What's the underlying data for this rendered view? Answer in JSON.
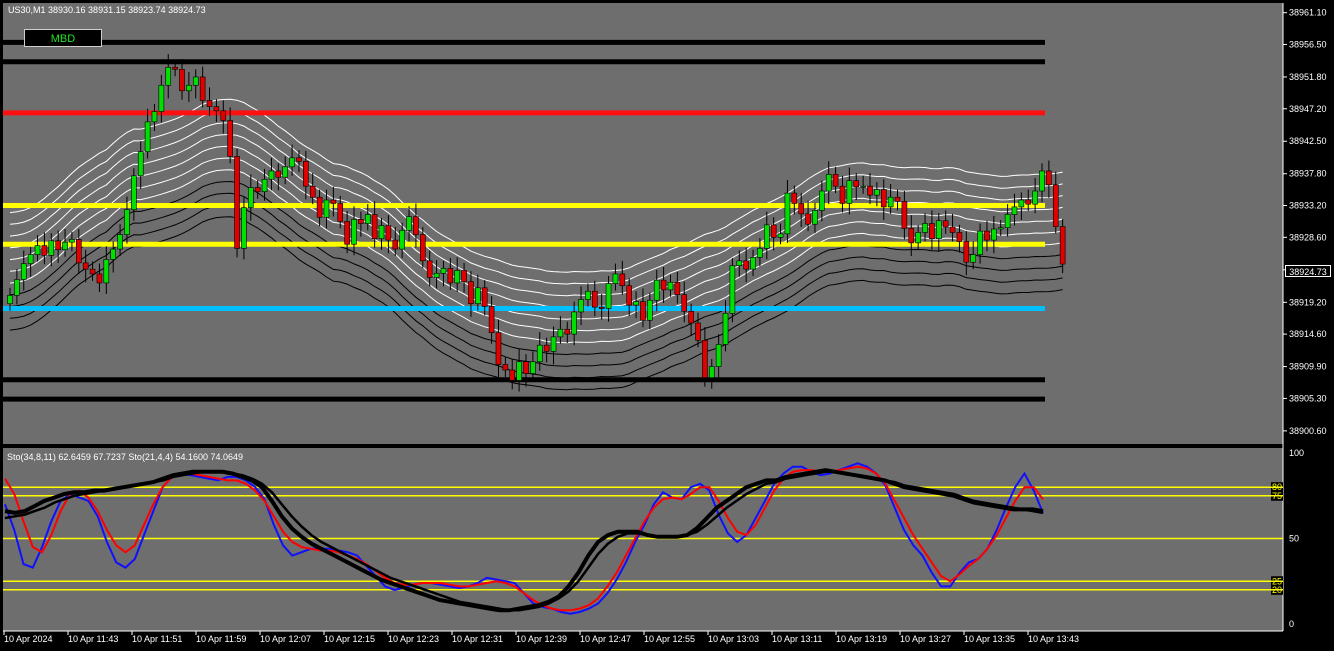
{
  "colors": {
    "background": "#000000",
    "plot_bg": "#6e6e6e",
    "bull": "#00e000",
    "bear": "#e00000",
    "envelope": "#ffffff",
    "level_black": "#000000",
    "level_red": "#ff1010",
    "level_yellow": "#ffff00",
    "level_blue": "#00c0ff",
    "stoch_blue": "#1010ff",
    "stoch_red": "#ff0000",
    "stoch_black": "#000000"
  },
  "header": {
    "symbol_line": "US30,M1  38930.16 38931.15 38923.74 38924.73"
  },
  "mbd_button": "MBD",
  "last_price": "38924.73",
  "chart_data": [
    {
      "type": "candlestick",
      "title": "US30,M1",
      "ohlc": {
        "open": 38930.16,
        "high": 38931.15,
        "low": 38923.74,
        "close": 38924.73
      },
      "ylim": [
        38898.7,
        38962.5
      ],
      "y_ticks": [
        "38961.10",
        "38956.50",
        "38951.80",
        "38947.20",
        "38942.50",
        "38937.80",
        "38933.20",
        "38928.60",
        "38923.90",
        "38919.20",
        "38914.60",
        "38909.90",
        "38905.30",
        "38900.60"
      ],
      "x_ticks": [
        "10 Apr 2024",
        "10 Apr 11:43",
        "10 Apr 11:51",
        "10 Apr 11:59",
        "10 Apr 12:07",
        "10 Apr 12:15",
        "10 Apr 12:23",
        "10 Apr 12:31",
        "10 Apr 12:39",
        "10 Apr 12:47",
        "10 Apr 12:55",
        "10 Apr 13:03",
        "10 Apr 13:11",
        "10 Apr 13:19",
        "10 Apr 13:27",
        "10 Apr 13:35",
        "10 Apr 13:43"
      ],
      "levels": [
        {
          "price": 38956.8,
          "color": "black"
        },
        {
          "price": 38954.0,
          "color": "black"
        },
        {
          "price": 38946.6,
          "color": "red"
        },
        {
          "price": 38933.2,
          "color": "yellow"
        },
        {
          "price": 38927.6,
          "color": "yellow"
        },
        {
          "price": 38918.3,
          "color": "blue"
        },
        {
          "price": 38908.0,
          "color": "black"
        },
        {
          "price": 38905.2,
          "color": "black"
        }
      ],
      "closes": [
        38920.2,
        38922.5,
        38924.8,
        38926.1,
        38927.4,
        38926.0,
        38928.1,
        38926.8,
        38927.9,
        38928.3,
        38924.9,
        38924.0,
        38923.3,
        38922.0,
        38925.4,
        38926.9,
        38929.0,
        38932.6,
        38937.5,
        38941.0,
        38945.3,
        38946.8,
        38950.6,
        38953.2,
        38952.9,
        38949.8,
        38950.6,
        38951.8,
        38948.4,
        38947.5,
        38946.9,
        38945.5,
        38940.3,
        38927.0,
        38932.9,
        38935.8,
        38935.2,
        38937.0,
        38938.2,
        38937.3,
        38938.8,
        38940.1,
        38939.6,
        38936.0,
        38934.4,
        38931.5,
        38934.0,
        38933.5,
        38930.9,
        38927.6,
        38931.2,
        38930.6,
        38931.9,
        38928.4,
        38930.3,
        38928.2,
        38926.9,
        38929.6,
        38931.6,
        38929.0,
        38925.2,
        38922.8,
        38923.4,
        38924.1,
        38922.0,
        38923.8,
        38922.2,
        38919.0,
        38921.3,
        38918.6,
        38914.8,
        38910.2,
        38909.4,
        38907.9,
        38910.6,
        38908.9,
        38910.6,
        38913.0,
        38912.1,
        38914.2,
        38915.3,
        38914.6,
        38917.8,
        38919.6,
        38920.8,
        38918.5,
        38918.3,
        38921.9,
        38923.3,
        38921.6,
        38918.8,
        38919.3,
        38916.6,
        38919.5,
        38922.4,
        38921.0,
        38922.1,
        38920.3,
        38917.9,
        38916.2,
        38913.7,
        38908.3,
        38909.9,
        38913.1,
        38917.6,
        38924.5,
        38925.2,
        38924.0,
        38925.7,
        38927.0,
        38930.4,
        38928.6,
        38929.1,
        38935.0,
        38933.5,
        38932.0,
        38930.5,
        38932.5,
        38935.3,
        38937.7,
        38936.0,
        38933.5,
        38936.8,
        38935.9,
        38936.0,
        38934.7,
        38935.5,
        38933.0,
        38934.4,
        38933.8,
        38929.9,
        38927.8,
        38929.3,
        38930.6,
        38928.4,
        38931.0,
        38930.1,
        38929.3,
        38928.0,
        38925.0,
        38926.1,
        38929.5,
        38928.2,
        38929.8,
        38930.0,
        38931.9,
        38933.0,
        38934.0,
        38933.4,
        38935.3,
        38938.2,
        38936.2,
        38930.16,
        38924.73
      ],
      "envelopes": {
        "bands": 11,
        "color": "white",
        "inner_bands_color": "black"
      }
    },
    {
      "type": "line",
      "title": "Sto(34,8,11) 62.6459 67.7237  Sto(21,4,4) 54.1600 74.0649",
      "ylim": [
        0,
        100
      ],
      "y_ticks": [
        "100",
        "80",
        "75",
        "50",
        "25",
        "20",
        "0"
      ],
      "levels": [
        80,
        75,
        50,
        25,
        20
      ],
      "series": [
        {
          "name": "Sto(21,4,4) main",
          "color": "blue",
          "values": [
            70,
            55,
            35,
            33,
            45,
            60,
            72,
            76,
            74,
            72,
            63,
            48,
            36,
            33,
            38,
            52,
            66,
            80,
            86,
            88,
            87,
            86,
            85,
            84,
            86,
            86,
            84,
            80,
            73,
            58,
            46,
            40,
            42,
            44,
            44,
            44,
            43,
            42,
            40,
            34,
            28,
            22,
            20,
            21,
            23,
            24,
            24,
            23,
            22,
            21,
            22,
            24,
            27,
            26,
            25,
            24,
            18,
            12,
            10,
            9,
            7,
            6,
            7,
            9,
            12,
            18,
            26,
            36,
            48,
            58,
            70,
            77,
            74,
            73,
            80,
            82,
            78,
            64,
            53,
            48,
            52,
            62,
            72,
            82,
            88,
            92,
            92,
            89,
            87,
            88,
            90,
            92,
            94,
            92,
            88,
            81,
            68,
            55,
            46,
            40,
            30,
            22,
            22,
            30,
            36,
            38,
            44,
            55,
            68,
            80,
            88,
            78,
            65
          ]
        },
        {
          "name": "Sto(21,4,4) signal",
          "color": "red",
          "values": [
            85,
            76,
            60,
            45,
            42,
            52,
            66,
            76,
            78,
            74,
            66,
            55,
            46,
            42,
            46,
            58,
            70,
            80,
            86,
            88,
            88,
            87,
            86,
            85,
            84,
            84,
            82,
            78,
            72,
            63,
            54,
            48,
            45,
            44,
            43,
            43,
            42,
            40,
            38,
            35,
            31,
            27,
            24,
            23,
            23,
            24,
            24,
            24,
            23,
            22,
            22,
            23,
            24,
            25,
            24,
            22,
            18,
            14,
            11,
            9,
            8,
            8,
            9,
            11,
            15,
            22,
            30,
            40,
            50,
            60,
            68,
            73,
            74,
            73,
            76,
            80,
            80,
            72,
            62,
            54,
            52,
            58,
            68,
            78,
            85,
            89,
            90,
            90,
            89,
            89,
            90,
            91,
            92,
            91,
            88,
            82,
            72,
            62,
            52,
            44,
            36,
            28,
            25,
            29,
            34,
            38,
            44,
            52,
            62,
            72,
            80,
            80,
            73
          ]
        },
        {
          "name": "Sto(34,8,11) main",
          "color": "black",
          "values": [
            66,
            65,
            66,
            69,
            72,
            74,
            76,
            77,
            77,
            78,
            78,
            79,
            80,
            81,
            82,
            83,
            85,
            87,
            88,
            89,
            89,
            89,
            89,
            88,
            86,
            84,
            80,
            72,
            63,
            56,
            51,
            47,
            44,
            41,
            38,
            35,
            32,
            29,
            26,
            24,
            22,
            20,
            18,
            16,
            14,
            13,
            12,
            11,
            10,
            9,
            8,
            8,
            9,
            10,
            11,
            13,
            16,
            22,
            30,
            40,
            48,
            52,
            54,
            54,
            54,
            52,
            51,
            51,
            51,
            52,
            56,
            62,
            68,
            72,
            76,
            80,
            82,
            84,
            84,
            86,
            87,
            88,
            89,
            90,
            89,
            88,
            87,
            86,
            85,
            84,
            82,
            80,
            79,
            78,
            77,
            76,
            75,
            73,
            71,
            70,
            69,
            68,
            67,
            67,
            67,
            66
          ]
        },
        {
          "name": "Sto(34,8,11) signal",
          "color": "black",
          "values": [
            62,
            63,
            64,
            66,
            68,
            71,
            73,
            75,
            76,
            77,
            78,
            79,
            80,
            81,
            82,
            83,
            84,
            86,
            87,
            88,
            89,
            89,
            89,
            88,
            87,
            85,
            82,
            77,
            70,
            63,
            57,
            52,
            48,
            45,
            42,
            39,
            36,
            33,
            30,
            27,
            25,
            23,
            21,
            19,
            17,
            15,
            13,
            12,
            11,
            10,
            9,
            8,
            8,
            9,
            10,
            12,
            15,
            19,
            25,
            33,
            41,
            47,
            51,
            53,
            53,
            52,
            51,
            51,
            51,
            52,
            54,
            58,
            63,
            68,
            72,
            76,
            79,
            82,
            83,
            85,
            86,
            87,
            88,
            89,
            89,
            88,
            87,
            86,
            85,
            84,
            83,
            81,
            80,
            79,
            78,
            77,
            76,
            74,
            72,
            71,
            70,
            69,
            68,
            67,
            66,
            65
          ]
        }
      ]
    }
  ]
}
